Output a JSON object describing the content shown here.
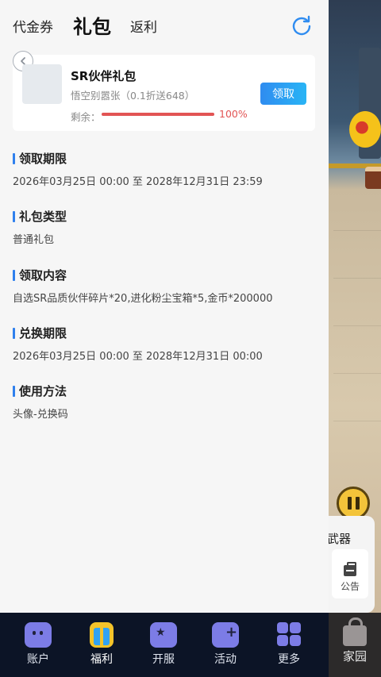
{
  "tabs": [
    {
      "label": "代金券"
    },
    {
      "label": "礼包"
    },
    {
      "label": "返利"
    }
  ],
  "card": {
    "title": "SR伙伴礼包",
    "subtitle": "悟空别嚣张（0.1折送648）",
    "remaining_label": "剩余：",
    "remaining_percent": "100%",
    "remaining_fraction": 1.0,
    "claim_button": "领取"
  },
  "sections": [
    {
      "title": "领取期限",
      "body": "2026年03月25日 00:00 至 2028年12月31日 23:59"
    },
    {
      "title": "礼包类型",
      "body": "普通礼包"
    },
    {
      "title": "领取内容",
      "body": "自选SR品质伙伴碎片*20,进化粉尘宝箱*5,金币*200000"
    },
    {
      "title": "兑换期限",
      "body": "2026年03月25日 00:00 至 2028年12月31日 00:00"
    },
    {
      "title": "使用方法",
      "body": "头像-兑换码"
    }
  ],
  "nav": [
    {
      "label": "账户",
      "icon": "account-icon"
    },
    {
      "label": "福利",
      "icon": "gift-icon"
    },
    {
      "label": "开服",
      "icon": "server-icon"
    },
    {
      "label": "活动",
      "icon": "gamepad-icon"
    },
    {
      "label": "更多",
      "icon": "grid-icon"
    }
  ],
  "game": {
    "side_weapon": "武器",
    "side_notice": "公告",
    "home_label": "家园"
  },
  "colors": {
    "accent": "#2f80ed",
    "progress": "#e25454",
    "nav_bg": "#0c1426",
    "nav_icon": "#7c7ce6"
  }
}
